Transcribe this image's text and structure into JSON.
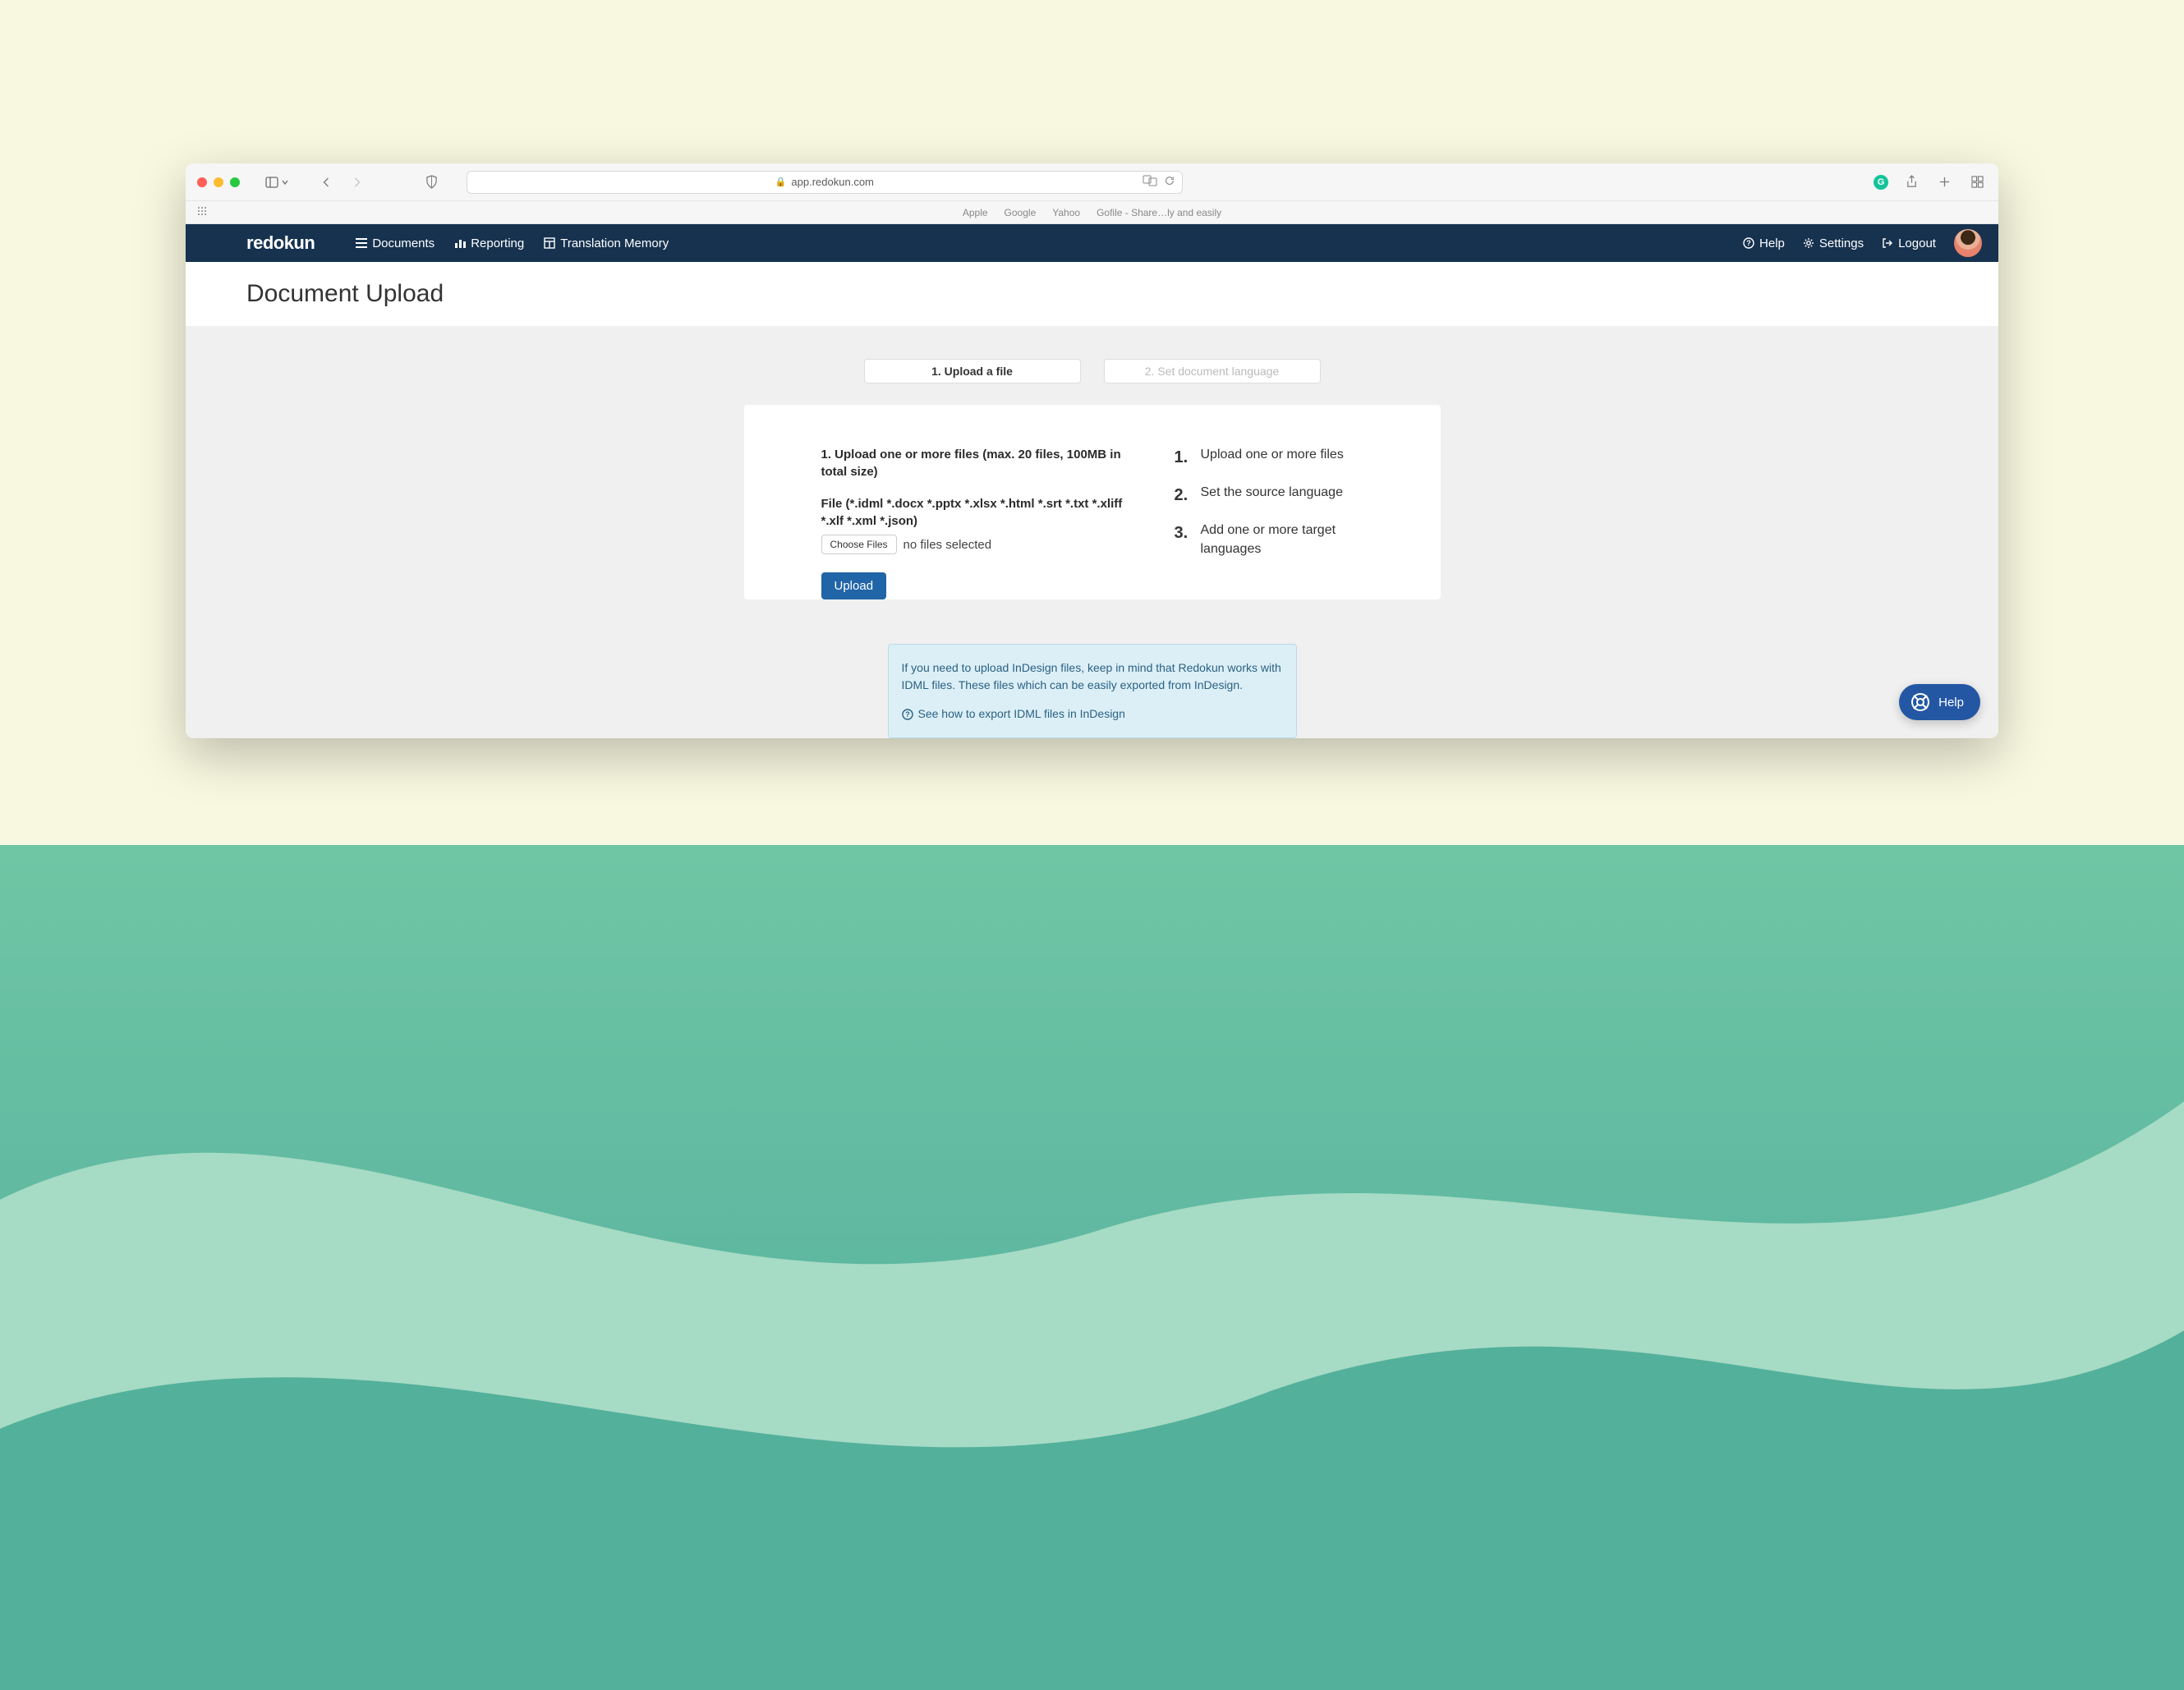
{
  "browser": {
    "url_host": "app.redokun.com",
    "bookmarks": [
      "Apple",
      "Google",
      "Yahoo",
      "Gofile - Share…ly and easily"
    ]
  },
  "header": {
    "logo": "redokun",
    "nav": {
      "documents": "Documents",
      "reporting": "Reporting",
      "tm": "Translation Memory"
    },
    "right": {
      "help": "Help",
      "settings": "Settings",
      "logout": "Logout"
    }
  },
  "page": {
    "title": "Document Upload",
    "tabs": {
      "step1": "1. Upload a file",
      "step2": "2. Set document language"
    }
  },
  "upload": {
    "heading": "1. Upload one or more files (max. 20 files, 100MB in total size)",
    "filetypes": "File (*.idml *.docx *.pptx *.xlsx *.html *.srt *.txt *.xliff *.xlf *.xml *.json)",
    "choose_label": "Choose Files",
    "no_files": "no files selected",
    "upload_label": "Upload"
  },
  "steps": {
    "s1_num": "1.",
    "s1_text": "Upload one or more files",
    "s2_num": "2.",
    "s2_text": "Set the source language",
    "s3_num": "3.",
    "s3_text": "Add one or more target languages"
  },
  "info": {
    "text": "If you need to upload InDesign files, keep in mind that Redokun works with IDML files. These files which can be easily exported from InDesign.",
    "link": "See how to export IDML files in InDesign"
  },
  "fab": {
    "label": "Help"
  }
}
